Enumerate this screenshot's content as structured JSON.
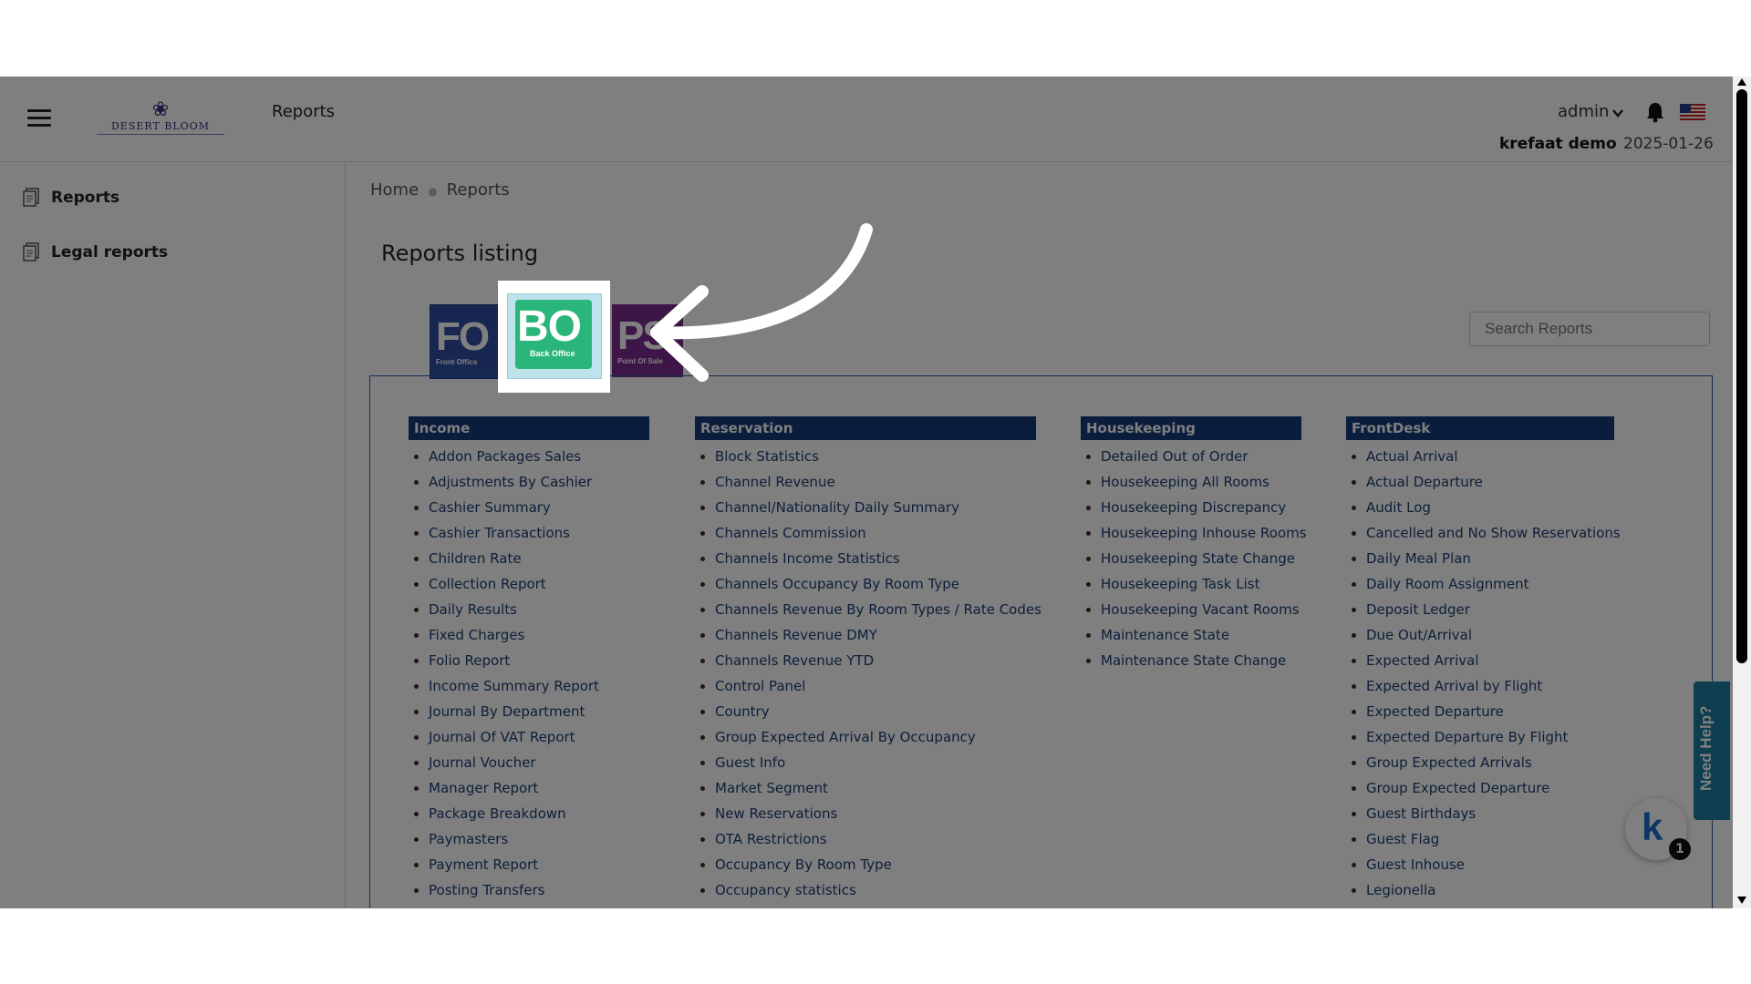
{
  "header": {
    "title": "Reports",
    "logo_text": "DESERT BLOOM",
    "user_menu": "admin",
    "property": "krefaat demo",
    "date": "2025-01-26"
  },
  "sidebar": {
    "items": [
      {
        "label": "Reports",
        "icon": "report-icon"
      },
      {
        "label": "Legal reports",
        "icon": "report-icon"
      }
    ]
  },
  "breadcrumb": {
    "home": "Home",
    "current": "Reports"
  },
  "page_title": "Reports listing",
  "tabs": [
    {
      "code": "FO",
      "subtitle": "Front Office",
      "color": "#2f4fa3"
    },
    {
      "code": "BO",
      "subtitle": "Back Office",
      "color": "#2ab67a"
    },
    {
      "code": "PS",
      "subtitle": "Point Of Sale",
      "color": "#7b2c8f"
    }
  ],
  "search": {
    "placeholder": "Search Reports"
  },
  "columns": [
    {
      "title": "Income",
      "items": [
        "Addon Packages Sales",
        "Adjustments By Cashier",
        "Cashier Summary",
        "Cashier Transactions",
        "Children Rate",
        "Collection Report",
        "Daily Results",
        "Fixed Charges",
        "Folio Report",
        "Income Summary Report",
        "Journal By Department",
        "Journal Of VAT Report",
        "Journal Voucher",
        "Manager Report",
        "Package Breakdown",
        "Paymasters",
        "Payment Report",
        "Posting Transfers"
      ]
    },
    {
      "title": "Reservation",
      "items": [
        "Block Statistics",
        "Channel Revenue",
        "Channel/Nationality Daily Summary",
        "Channels Commission",
        "Channels Income Statistics",
        "Channels Occupancy By Room Type",
        "Channels Revenue By Room Types / Rate Codes",
        "Channels Revenue DMY",
        "Channels Revenue YTD",
        "Control Panel",
        "Country",
        "Group Expected Arrival By Occupancy",
        "Guest Info",
        "Market Segment",
        "New Reservations",
        "OTA Restrictions",
        "Occupancy By Room Type",
        "Occupancy statistics"
      ]
    },
    {
      "title": "Housekeeping",
      "items": [
        "Detailed Out of Order",
        "Housekeeping All Rooms",
        "Housekeeping Discrepancy",
        "Housekeeping Inhouse Rooms",
        "Housekeeping State Change",
        "Housekeeping Task List",
        "Housekeeping Vacant Rooms",
        "Maintenance State",
        "Maintenance State Change"
      ]
    },
    {
      "title": "FrontDesk",
      "items": [
        "Actual Arrival",
        "Actual Departure",
        "Audit Log",
        "Cancelled and No Show Reservations",
        "Daily Meal Plan",
        "Daily Room Assignment",
        "Deposit Ledger",
        "Due Out/Arrival",
        "Expected Arrival",
        "Expected Arrival by Flight",
        "Expected Departure",
        "Expected Departure By Flight",
        "Group Expected Arrivals",
        "Group Expected Departure",
        "Guest Birthdays",
        "Guest Flag",
        "Guest Inhouse",
        "Legionella"
      ]
    }
  ],
  "help": {
    "label": "Need Help?"
  },
  "chat": {
    "badge": "1",
    "letter": "k"
  },
  "colors": {
    "header_bar": "#143a7b",
    "link": "#1a3f73",
    "help": "#1a7fa0"
  }
}
